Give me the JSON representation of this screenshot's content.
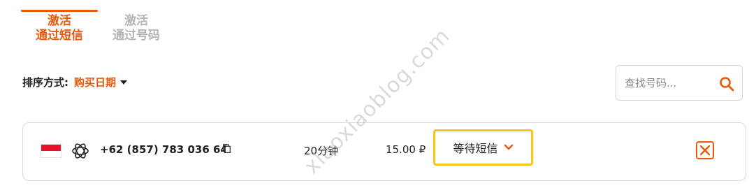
{
  "tabs": [
    {
      "line1": "激活",
      "line2": "通过短信",
      "active": true
    },
    {
      "line1": "激活",
      "line2": "通过号码",
      "active": false
    }
  ],
  "sort": {
    "label": "排序方式:",
    "value": "购买日期"
  },
  "search": {
    "placeholder": "查找号码..."
  },
  "order": {
    "country_flag": "indonesia-flag",
    "service_icon": "openai-icon",
    "phone": "+62 (857) 783 036 64",
    "duration": "20分钟",
    "price": "15.00 ₽",
    "status": "等待短信"
  },
  "watermark": "xiaoxiaoblog.com",
  "colors": {
    "accent": "#e8590c",
    "highlight": "#f5c518",
    "inactive_tab": "#b5b5b5"
  }
}
